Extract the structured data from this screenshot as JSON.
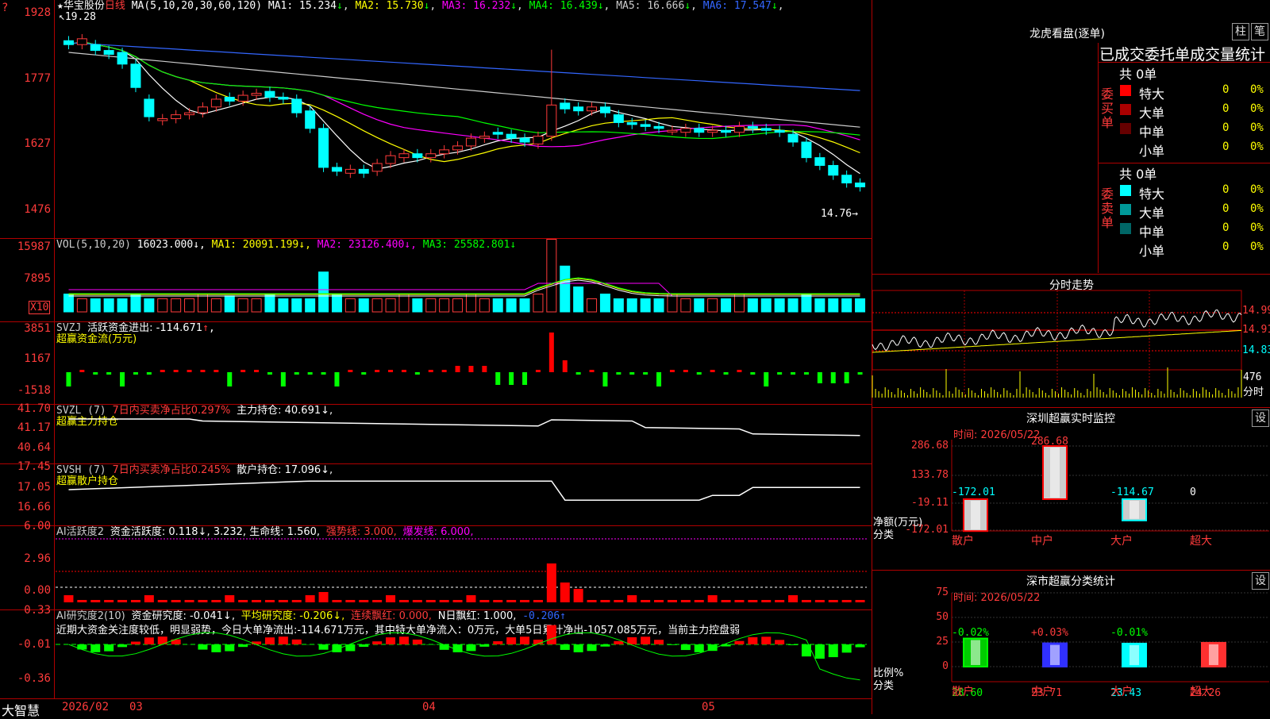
{
  "stock": {
    "star": "★",
    "name": "华宝股份",
    "period": "日线"
  },
  "ma": {
    "prefix": "MA(5,10,20,30,60,120)",
    "items": [
      {
        "label": "MA1: 15.234",
        "arrow": "↓",
        "color": "#ffffff"
      },
      {
        "label": "MA2: 15.730",
        "arrow": "↓",
        "color": "#ffff00"
      },
      {
        "label": "MA3: 16.232",
        "arrow": "↓",
        "color": "#ff00ff"
      },
      {
        "label": "MA4: 16.439",
        "arrow": "↓",
        "color": "#00ff00"
      },
      {
        "label": "MA5: 16.666",
        "arrow": "↓",
        "color": "#cccccc"
      },
      {
        "label": "MA6: 17.547",
        "arrow": "↓",
        "color": "#3366ff"
      }
    ]
  },
  "price_axis": {
    "ticks": [
      "1928",
      "1777",
      "1627",
      "1476"
    ],
    "top_mark": "?"
  },
  "price_annotations": {
    "high": "19.28",
    "low": "14.76→"
  },
  "vol": {
    "prefix": "VOL(5,10,20)",
    "value": "16023.000↓,",
    "ma1": "MA1: 20091.199↓,",
    "ma2": "MA2: 23126.400↓,",
    "ma3": "MA3: 25582.801↓",
    "ticks": [
      "15987",
      "7895"
    ],
    "unit": "X10"
  },
  "svzj": {
    "prefix": "SVZJ",
    "title": "活跃资金进出: -114.671",
    "arrow": "↑",
    "tail": ",",
    "subtitle": "超赢资金流(万元)",
    "ticks": [
      "3851",
      "1167",
      "-1518"
    ]
  },
  "svzl": {
    "prefix": "SVZL (7)",
    "ratio": "7日内买卖净占比0.297%",
    "hold": "主力持仓: 40.691↓,",
    "subtitle": "超赢主力持仓",
    "ticks": [
      "41.70",
      "41.17",
      "40.64"
    ]
  },
  "svsh": {
    "prefix": "SVSH (7)",
    "ratio": "7日内买卖净占比0.245%",
    "hold": "散户持仓: 17.096↓,",
    "subtitle": "超赢散户持仓",
    "ticks": [
      "17.45",
      "17.05",
      "16.66"
    ]
  },
  "ai1": {
    "prefix": "AI活跃度2",
    "a": "资金活跃度: 0.118↓, 3.232, 生命线: 1.560,",
    "b": "强势线: 3.000,",
    "c": "爆发线: 6.000,",
    "ticks": [
      "6.00",
      "2.96",
      "0.00"
    ]
  },
  "ai2": {
    "prefix": "AI研究度2(10)",
    "a": "资金研究度: -0.041↓,",
    "b": "平均研究度: -0.206↓,",
    "c": "连续飘红: 0.000,",
    "d": "N日飘红: 1.000,",
    "e": "-0.206↑",
    "ticks": [
      "0.33",
      "-0.01",
      "-0.36"
    ],
    "comment": "近期大资金关注度较低，明显弱势，今日大单净流出:-114.671万元，其中特大单净流入：0万元，大单5日累计净出-1057.085万元，当前主力控盘弱"
  },
  "date_axis": {
    "brand": "大智慧",
    "labels": [
      "2026/02",
      "03",
      "04",
      "05"
    ]
  },
  "dragon": {
    "title": "龙虎看盘(逐单)",
    "btn1": "柱",
    "btn2": "笔",
    "subtitle": "已成交委托单成交量统计",
    "buy": {
      "side": "委买单",
      "count": "共 0单",
      "rows": [
        {
          "name": "特大",
          "val": "0",
          "pct": "0%",
          "color": "#ff0000"
        },
        {
          "name": "大单",
          "val": "0",
          "pct": "0%",
          "color": "#aa0000"
        },
        {
          "name": "中单",
          "val": "0",
          "pct": "0%",
          "color": "#660000"
        },
        {
          "name": "小单",
          "val": "0",
          "pct": "0%",
          "color": "#000000"
        }
      ]
    },
    "sell": {
      "side": "委卖单",
      "count": "共 0单",
      "rows": [
        {
          "name": "特大",
          "val": "0",
          "pct": "0%",
          "color": "#00ffff"
        },
        {
          "name": "大单",
          "val": "0",
          "pct": "0%",
          "color": "#009999"
        },
        {
          "name": "中单",
          "val": "0",
          "pct": "0%",
          "color": "#006666"
        },
        {
          "name": "小单",
          "val": "0",
          "pct": "0%",
          "color": "#000000"
        }
      ]
    }
  },
  "intraday": {
    "title": "分时走势",
    "ticks": [
      "14.99",
      "14.91",
      "14.83"
    ],
    "vol_tick": "476",
    "vol_label": "分时"
  },
  "monitor": {
    "title": "深圳超赢实时监控",
    "btn": "设",
    "time": "时间: 2026/05/22",
    "ticks": [
      "286.68",
      "133.78",
      "-19.11",
      "-172.01"
    ],
    "ylabel": "净额(万元)",
    "xlabel": "分类",
    "chart_data": {
      "type": "bar",
      "categories": [
        "散户",
        "中户",
        "大户",
        "超大"
      ],
      "values": [
        -172.01,
        286.68,
        -114.67,
        0
      ],
      "value_labels": [
        "-172.01",
        "286.68",
        "-114.67",
        "0"
      ],
      "ylim": [
        -172.01,
        286.68
      ]
    }
  },
  "classify": {
    "title": "深市超赢分类统计",
    "btn": "设",
    "time": "时间: 2026/05/22",
    "ticks": [
      "75",
      "50",
      "25",
      "0"
    ],
    "ylabel": "比例%",
    "xlabel": "分类",
    "chart_data": {
      "type": "bar",
      "categories": [
        "散户",
        "中户",
        "大户",
        "超大"
      ],
      "values": [
        28.6,
        23.71,
        23.43,
        24.26
      ],
      "changes": [
        "-0.02%",
        "+0.03%",
        "-0.01%",
        ""
      ],
      "value_labels": [
        "28.60",
        "23.71",
        "23.43",
        "24.26"
      ],
      "ylim": [
        0,
        75
      ]
    }
  }
}
